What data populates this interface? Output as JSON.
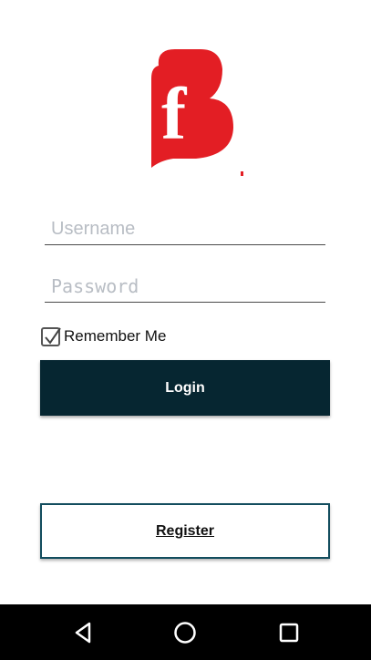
{
  "logo": {
    "letter": "f",
    "brand_color": "#e31e24",
    "icon": "brand-logo-icon"
  },
  "login_form": {
    "username": {
      "placeholder": "Username",
      "value": ""
    },
    "password": {
      "placeholder": "Password",
      "value": ""
    },
    "remember_me": {
      "label": "Remember Me",
      "checked": true
    },
    "login_button": {
      "label": "Login",
      "color": "#062631"
    },
    "register_button": {
      "label": "Register",
      "border_color": "#134d5e"
    }
  },
  "nav_bar": {
    "back_icon": "back-triangle-icon",
    "home_icon": "home-circle-icon",
    "recents_icon": "recents-square-icon"
  }
}
